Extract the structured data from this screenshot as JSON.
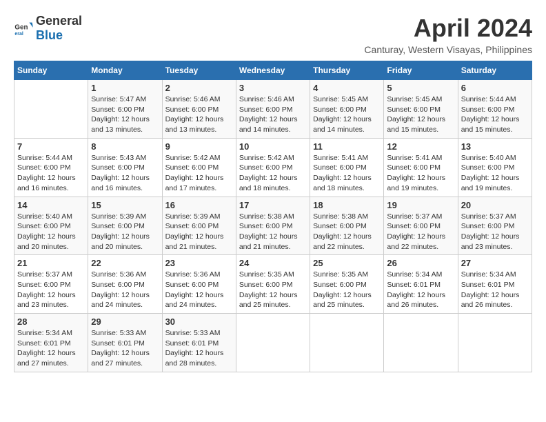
{
  "logo": {
    "general": "General",
    "blue": "Blue"
  },
  "title": "April 2024",
  "subtitle": "Canturay, Western Visayas, Philippines",
  "headers": [
    "Sunday",
    "Monday",
    "Tuesday",
    "Wednesday",
    "Thursday",
    "Friday",
    "Saturday"
  ],
  "weeks": [
    [
      {
        "day": "",
        "info": ""
      },
      {
        "day": "1",
        "info": "Sunrise: 5:47 AM\nSunset: 6:00 PM\nDaylight: 12 hours\nand 13 minutes."
      },
      {
        "day": "2",
        "info": "Sunrise: 5:46 AM\nSunset: 6:00 PM\nDaylight: 12 hours\nand 13 minutes."
      },
      {
        "day": "3",
        "info": "Sunrise: 5:46 AM\nSunset: 6:00 PM\nDaylight: 12 hours\nand 14 minutes."
      },
      {
        "day": "4",
        "info": "Sunrise: 5:45 AM\nSunset: 6:00 PM\nDaylight: 12 hours\nand 14 minutes."
      },
      {
        "day": "5",
        "info": "Sunrise: 5:45 AM\nSunset: 6:00 PM\nDaylight: 12 hours\nand 15 minutes."
      },
      {
        "day": "6",
        "info": "Sunrise: 5:44 AM\nSunset: 6:00 PM\nDaylight: 12 hours\nand 15 minutes."
      }
    ],
    [
      {
        "day": "7",
        "info": "Sunrise: 5:44 AM\nSunset: 6:00 PM\nDaylight: 12 hours\nand 16 minutes."
      },
      {
        "day": "8",
        "info": "Sunrise: 5:43 AM\nSunset: 6:00 PM\nDaylight: 12 hours\nand 16 minutes."
      },
      {
        "day": "9",
        "info": "Sunrise: 5:42 AM\nSunset: 6:00 PM\nDaylight: 12 hours\nand 17 minutes."
      },
      {
        "day": "10",
        "info": "Sunrise: 5:42 AM\nSunset: 6:00 PM\nDaylight: 12 hours\nand 18 minutes."
      },
      {
        "day": "11",
        "info": "Sunrise: 5:41 AM\nSunset: 6:00 PM\nDaylight: 12 hours\nand 18 minutes."
      },
      {
        "day": "12",
        "info": "Sunrise: 5:41 AM\nSunset: 6:00 PM\nDaylight: 12 hours\nand 19 minutes."
      },
      {
        "day": "13",
        "info": "Sunrise: 5:40 AM\nSunset: 6:00 PM\nDaylight: 12 hours\nand 19 minutes."
      }
    ],
    [
      {
        "day": "14",
        "info": "Sunrise: 5:40 AM\nSunset: 6:00 PM\nDaylight: 12 hours\nand 20 minutes."
      },
      {
        "day": "15",
        "info": "Sunrise: 5:39 AM\nSunset: 6:00 PM\nDaylight: 12 hours\nand 20 minutes."
      },
      {
        "day": "16",
        "info": "Sunrise: 5:39 AM\nSunset: 6:00 PM\nDaylight: 12 hours\nand 21 minutes."
      },
      {
        "day": "17",
        "info": "Sunrise: 5:38 AM\nSunset: 6:00 PM\nDaylight: 12 hours\nand 21 minutes."
      },
      {
        "day": "18",
        "info": "Sunrise: 5:38 AM\nSunset: 6:00 PM\nDaylight: 12 hours\nand 22 minutes."
      },
      {
        "day": "19",
        "info": "Sunrise: 5:37 AM\nSunset: 6:00 PM\nDaylight: 12 hours\nand 22 minutes."
      },
      {
        "day": "20",
        "info": "Sunrise: 5:37 AM\nSunset: 6:00 PM\nDaylight: 12 hours\nand 23 minutes."
      }
    ],
    [
      {
        "day": "21",
        "info": "Sunrise: 5:37 AM\nSunset: 6:00 PM\nDaylight: 12 hours\nand 23 minutes."
      },
      {
        "day": "22",
        "info": "Sunrise: 5:36 AM\nSunset: 6:00 PM\nDaylight: 12 hours\nand 24 minutes."
      },
      {
        "day": "23",
        "info": "Sunrise: 5:36 AM\nSunset: 6:00 PM\nDaylight: 12 hours\nand 24 minutes."
      },
      {
        "day": "24",
        "info": "Sunrise: 5:35 AM\nSunset: 6:00 PM\nDaylight: 12 hours\nand 25 minutes."
      },
      {
        "day": "25",
        "info": "Sunrise: 5:35 AM\nSunset: 6:00 PM\nDaylight: 12 hours\nand 25 minutes."
      },
      {
        "day": "26",
        "info": "Sunrise: 5:34 AM\nSunset: 6:01 PM\nDaylight: 12 hours\nand 26 minutes."
      },
      {
        "day": "27",
        "info": "Sunrise: 5:34 AM\nSunset: 6:01 PM\nDaylight: 12 hours\nand 26 minutes."
      }
    ],
    [
      {
        "day": "28",
        "info": "Sunrise: 5:34 AM\nSunset: 6:01 PM\nDaylight: 12 hours\nand 27 minutes."
      },
      {
        "day": "29",
        "info": "Sunrise: 5:33 AM\nSunset: 6:01 PM\nDaylight: 12 hours\nand 27 minutes."
      },
      {
        "day": "30",
        "info": "Sunrise: 5:33 AM\nSunset: 6:01 PM\nDaylight: 12 hours\nand 28 minutes."
      },
      {
        "day": "",
        "info": ""
      },
      {
        "day": "",
        "info": ""
      },
      {
        "day": "",
        "info": ""
      },
      {
        "day": "",
        "info": ""
      }
    ]
  ]
}
